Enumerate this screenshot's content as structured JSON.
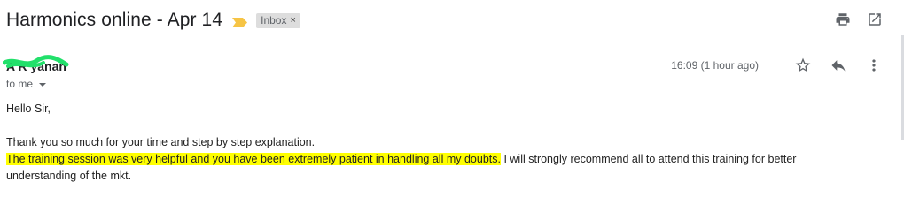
{
  "email": {
    "subject": "Harmonics online - Apr 14",
    "label": "Inbox",
    "label_remove": "×",
    "sender": "A     R      yanan",
    "recipient": "to me",
    "time": "16:09 (1 hour ago)",
    "greeting": "Hello Sir,",
    "line1": "Thank you so much for your time and step by step explanation.",
    "highlighted": "The training session was very helpful and you have been extremely patient in handling all my doubts.",
    "continuation": " I will strongly recommend all to attend this training for better understanding of the mkt."
  },
  "colors": {
    "highlight": "#ffff00",
    "importance_marker": "#f6c445",
    "redaction_scribble": "#22e06b"
  },
  "icons": {
    "print": "print-icon",
    "open_new_window": "open-in-new-window-icon",
    "star": "star-icon",
    "reply": "reply-icon",
    "more": "more-vert-icon",
    "importance": "importance-marker-icon",
    "dropdown": "chevron-down-icon"
  }
}
